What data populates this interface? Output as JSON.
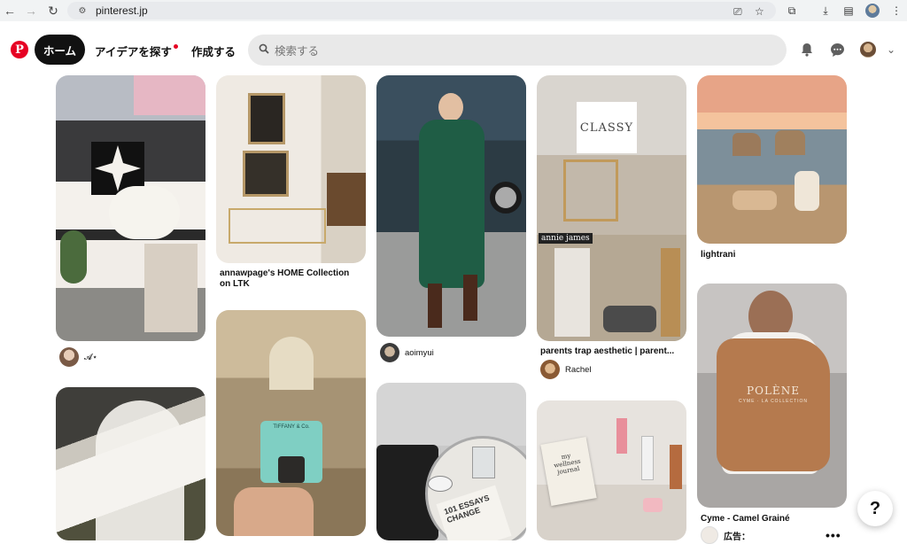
{
  "browser": {
    "url": "pinterest.jp"
  },
  "header": {
    "home_label": "ホーム",
    "explore_label": "アイデアを探す",
    "create_label": "作成する",
    "search_placeholder": "検索する"
  },
  "pins": [
    {
      "id": "pin-1",
      "user": "𝓐⋆"
    },
    {
      "id": "pin-2",
      "title_line1": "annawpage's HOME Collection",
      "title_line2": "on LTK"
    },
    {
      "id": "pin-3",
      "user": "aoimyui"
    },
    {
      "id": "pin-4",
      "title": "parents trap aesthetic | parent...",
      "user": "Rachel",
      "overlay_classy": "CLASSY",
      "overlay_annie": "annie james"
    },
    {
      "id": "pin-5",
      "title": "lightrani"
    },
    {
      "id": "pin-6",
      "title": "Cyme - Camel Grainé",
      "ad_label": "広告：",
      "overlay_brand": "POLÈNE",
      "overlay_sub": "CYME · LA COLLECTION"
    },
    {
      "id": "pin-7",
      "overlay_box": "TIFFANY & Co."
    },
    {
      "id": "pin-8",
      "overlay_book": "101 ESSAYS CHANGE"
    },
    {
      "id": "pin-9",
      "overlay_journal": "my wellness journal"
    }
  ],
  "help_label": "?",
  "more_label": "•••"
}
